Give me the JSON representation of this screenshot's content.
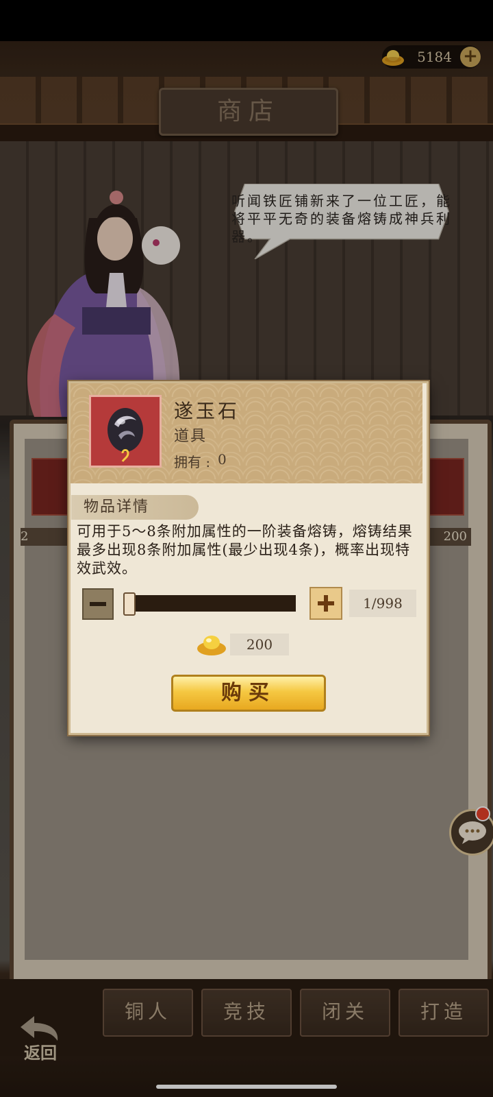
{
  "header": {
    "title": "商店",
    "gold_amount": "5184",
    "add_gold_symbol": "+"
  },
  "npc": {
    "speech": "听闻铁匠铺新来了一位工匠，能将平平无奇的装备熔铸成神兵利器。"
  },
  "shop": {
    "left_card_price": "2",
    "right_card_price": "200"
  },
  "dialog": {
    "item_name": "遂玉石",
    "item_type": "道具",
    "owned_label": "拥有 :",
    "owned_value": "0",
    "detail_tab": "物品详情",
    "description": "可用于5～8条附加属性的一阶装备熔铸，熔铸结果最多出现8条附加属性(最少出现4条)，概率出现特效武效。",
    "quantity": "1/998",
    "quantity_fraction": 0.001,
    "price": "200",
    "buy_label": "购买",
    "minus_symbol": "−",
    "plus_symbol": "+"
  },
  "tabs": [
    {
      "label": "铜人"
    },
    {
      "label": "竞技"
    },
    {
      "label": "闭关"
    },
    {
      "label": "打造"
    }
  ],
  "back_label": "返回",
  "colors": {
    "accent_gold": "#f5c842",
    "item_frame_red": "#b53a3a",
    "notification_red": "#e8402a"
  }
}
